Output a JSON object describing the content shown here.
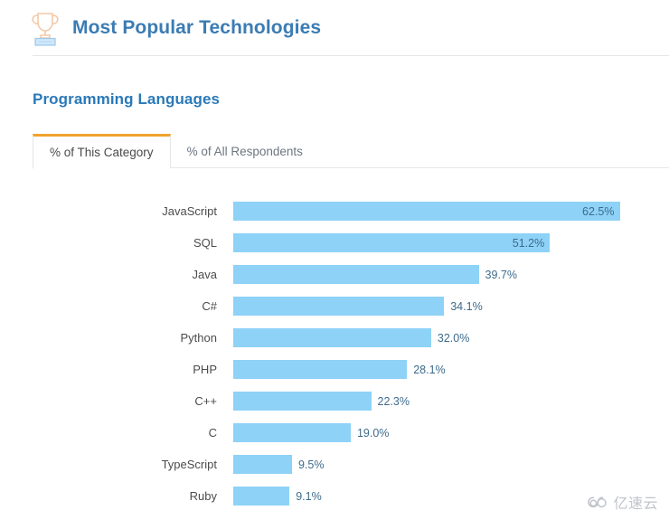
{
  "header": {
    "title": "Most Popular Technologies",
    "icon": "trophy-icon"
  },
  "section": {
    "title": "Programming Languages"
  },
  "tabs": [
    {
      "label": "% of This Category",
      "active": true
    },
    {
      "label": "% of All Respondents",
      "active": false
    }
  ],
  "colors": {
    "title": "#3b7cb3",
    "section_title": "#2a79b8",
    "bar": "#8ed2f7",
    "active_tab_accent": "#f0a32c",
    "value_text": "#3d6b8c",
    "label_text": "#4c4c4c",
    "divider": "#e4e7ea"
  },
  "watermark": {
    "text": "亿速云",
    "icon": "cloud-icon"
  },
  "chart_data": {
    "type": "bar",
    "orientation": "horizontal",
    "title": "Programming Languages",
    "subtitle": "% of This Category",
    "xlabel": "",
    "ylabel": "",
    "xlim": [
      0,
      67
    ],
    "grid": false,
    "legend": "none",
    "value_suffix": "%",
    "categories": [
      "JavaScript",
      "SQL",
      "Java",
      "C#",
      "Python",
      "PHP",
      "C++",
      "C",
      "TypeScript",
      "Ruby"
    ],
    "values": [
      62.5,
      51.2,
      39.7,
      34.1,
      32.0,
      28.1,
      22.3,
      19.0,
      9.5,
      9.1
    ],
    "labels": [
      "62.5%",
      "51.2%",
      "39.7%",
      "34.1%",
      "32.0%",
      "28.1%",
      "22.3%",
      "19.0%",
      "9.5%",
      "9.1%"
    ],
    "label_position": [
      "inside",
      "inside",
      "outside",
      "outside",
      "outside",
      "outside",
      "outside",
      "outside",
      "outside",
      "outside"
    ]
  }
}
